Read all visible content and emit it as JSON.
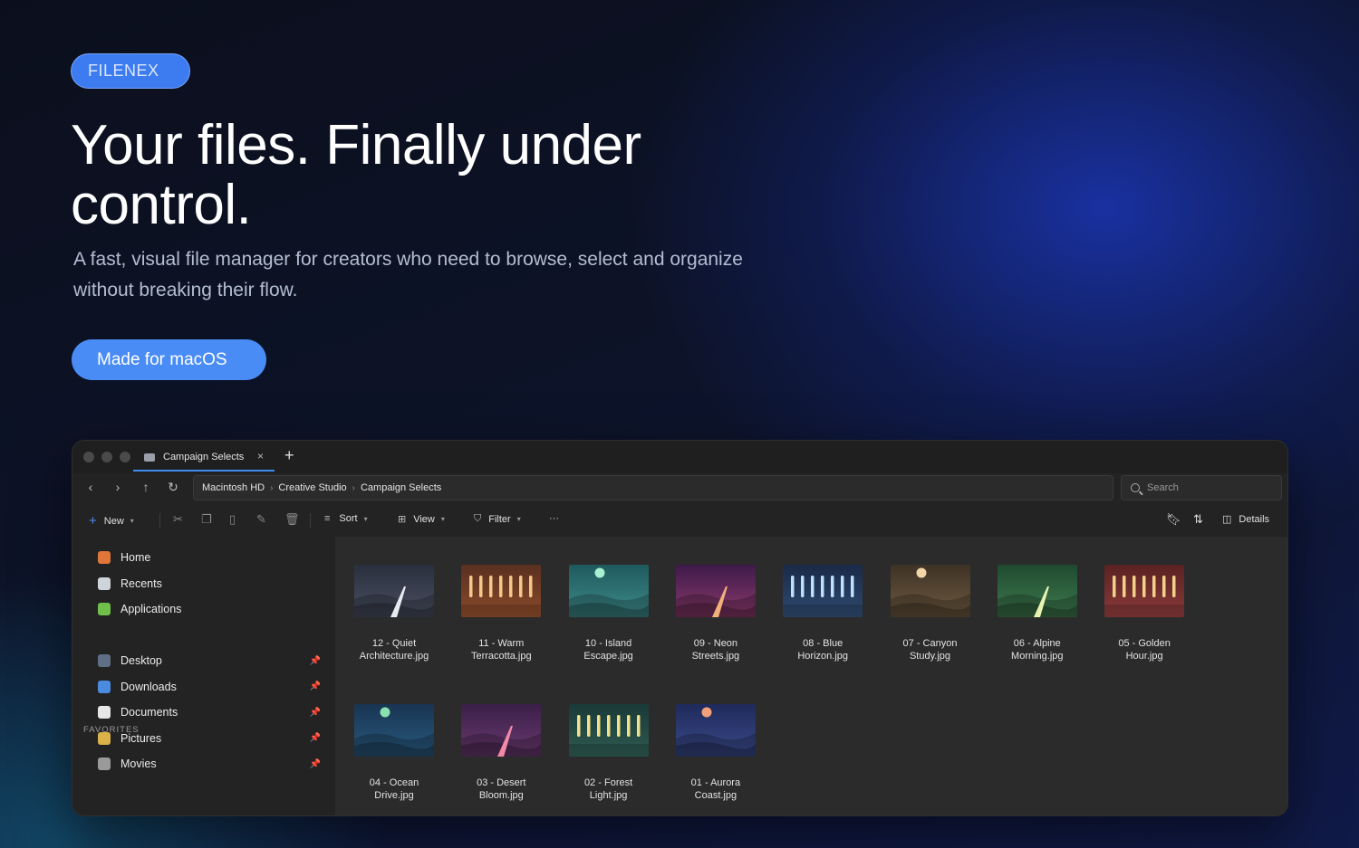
{
  "hero": {
    "badge": "FILENEX",
    "headline": "Your files. Finally under control.",
    "subtitle": "A fast, visual file manager for creators who need to browse, select and organize without breaking their flow.",
    "cta": "Made for macOS"
  },
  "window": {
    "tab_title": "Campaign Selects",
    "tab_close": "×",
    "new_tab": "+",
    "breadcrumb": [
      "Macintosh HD",
      "Creative Studio",
      "Campaign Selects"
    ],
    "breadcrumb_sep": "›",
    "search_placeholder": "Search",
    "toolbar": {
      "new_label": "New",
      "sort_label": "Sort",
      "view_label": "View",
      "filter_label": "Filter",
      "more_label": "···",
      "details_label": "Details"
    },
    "sidebar": {
      "places": [
        {
          "label": "Home",
          "icon": "home-icon",
          "color": "#e0763a"
        },
        {
          "label": "Recents",
          "icon": "clock-icon",
          "color": "#cfd3da"
        },
        {
          "label": "Applications",
          "icon": "puzzle-icon",
          "color": "#6fbf4a"
        }
      ],
      "favorites_heading": "FAVORITES",
      "favorites": [
        {
          "label": "Desktop",
          "icon": "desktop-icon",
          "color": "#5f6f85"
        },
        {
          "label": "Downloads",
          "icon": "download-icon",
          "color": "#4a8be0"
        },
        {
          "label": "Documents",
          "icon": "document-icon",
          "color": "#e6e6e6"
        },
        {
          "label": "Pictures",
          "icon": "picture-icon",
          "color": "#d9b24a"
        },
        {
          "label": "Movies",
          "icon": "clapper-icon",
          "color": "#9a9a9a"
        }
      ],
      "pin_glyph": "📌"
    },
    "files": [
      {
        "line1": "12 - Quiet",
        "line2": "Architecture.jpg",
        "style": "road",
        "bg": [
          "#2a2f3d",
          "#4a5062"
        ],
        "accent": "#e8ecf2"
      },
      {
        "line1": "11 - Warm",
        "line2": "Terracotta.jpg",
        "style": "bars",
        "bg": [
          "#5a3020",
          "#8a4a2a"
        ],
        "accent": "#f2c98a"
      },
      {
        "line1": "10 - Island",
        "line2": "Escape.jpg",
        "style": "moon",
        "bg": [
          "#1e5a5e",
          "#3f8a8a"
        ],
        "accent": "#a8f0d0"
      },
      {
        "line1": "09 - Neon",
        "line2": "Streets.jpg",
        "style": "road",
        "bg": [
          "#3d1a4a",
          "#8a3a6a"
        ],
        "accent": "#f2b07a"
      },
      {
        "line1": "08 - Blue",
        "line2": "Horizon.jpg",
        "style": "bars",
        "bg": [
          "#1a2a48",
          "#2e4a6e"
        ],
        "accent": "#bfe0ff"
      },
      {
        "line1": "07 - Canyon",
        "line2": "Study.jpg",
        "style": "moon",
        "bg": [
          "#3e3226",
          "#6e5a40"
        ],
        "accent": "#f2d6a8"
      },
      {
        "line1": "06 - Alpine",
        "line2": "Morning.jpg",
        "style": "road",
        "bg": [
          "#1f4a30",
          "#3f7a4e"
        ],
        "accent": "#e8f2b0"
      },
      {
        "line1": "05 - Golden",
        "line2": "Hour.jpg",
        "style": "bars",
        "bg": [
          "#5a2222",
          "#8a3a3a"
        ],
        "accent": "#f2d08a"
      },
      {
        "line1": "04 - Ocean",
        "line2": "Drive.jpg",
        "style": "moon",
        "bg": [
          "#183452",
          "#2a5a7e"
        ],
        "accent": "#8ae0b0"
      },
      {
        "line1": "03 - Desert",
        "line2": "Bloom.jpg",
        "style": "road",
        "bg": [
          "#3a1f48",
          "#6a3a70"
        ],
        "accent": "#f28aa8"
      },
      {
        "line1": "02 - Forest",
        "line2": "Light.jpg",
        "style": "bars",
        "bg": [
          "#1a3a38",
          "#2e5a50"
        ],
        "accent": "#f2e08a"
      },
      {
        "line1": "01 - Aurora",
        "line2": "Coast.jpg",
        "style": "moon",
        "bg": [
          "#1f2a5a",
          "#3a4a8a"
        ],
        "accent": "#f2a07a"
      }
    ]
  }
}
